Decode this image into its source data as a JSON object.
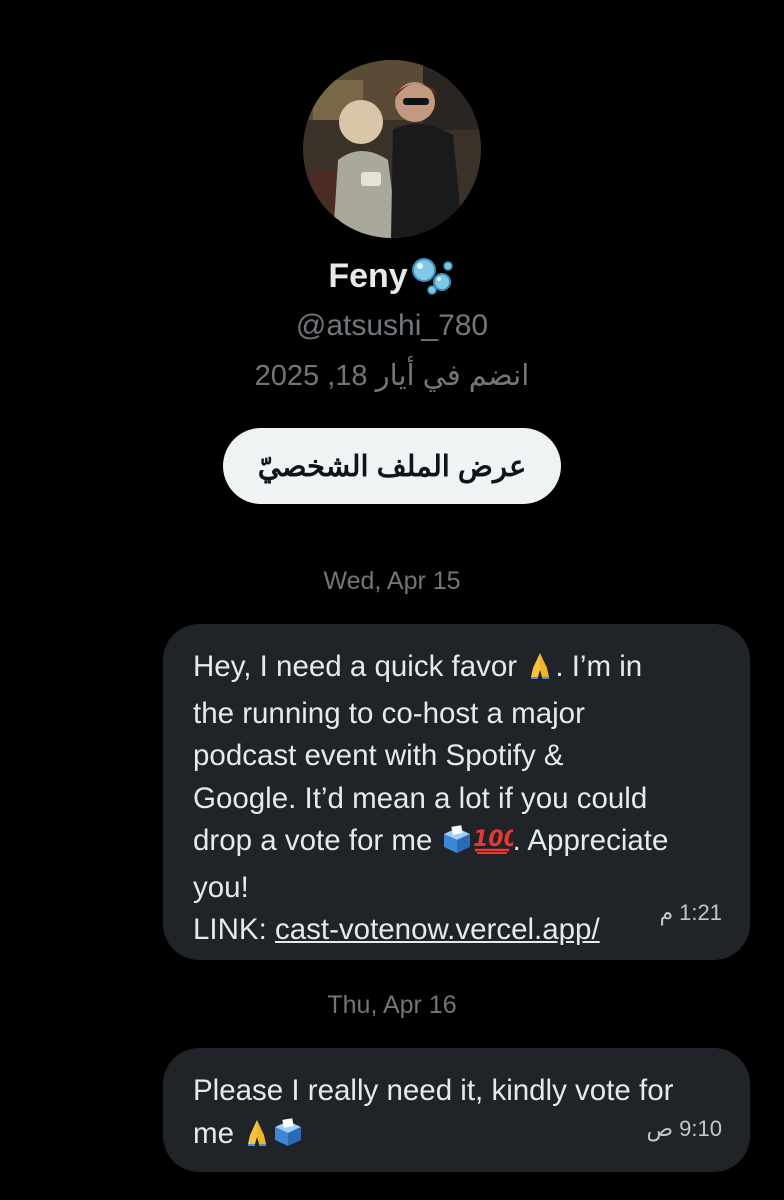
{
  "profile": {
    "display_name": "Feny",
    "name_icon": "bubbles-icon",
    "handle": "@atsushi_780",
    "joined": "انضم في أيار 18, 2025",
    "view_profile_label": "عرض الملف الشخصيّ"
  },
  "conversation": {
    "dates": [
      "Wed, Apr 15",
      "Thu, Apr 16"
    ],
    "messages": [
      {
        "text_line_1": "Hey, I need a quick favor ",
        "text_line_1b": ". I’m in",
        "text_rest": "the running to co-host a major\npodcast event with Spotify &\nGoogle. It’d mean a lot if you could\ndrop a vote for me ",
        "text_after_emoji": ". Appreciate\nyou!",
        "link_prefix": "LINK: ",
        "link_text": "cast-votenow.vercel.app/",
        "time": "1:21 م"
      },
      {
        "text_line_1": "Please I really need it, kindly vote for",
        "text_line_2": "me ",
        "time": "9:10 ص"
      }
    ]
  },
  "icons": {
    "pray": "folded-hands-icon",
    "ballot": "ballot-box-icon",
    "hundred": "hundred-points-icon"
  },
  "colors": {
    "background": "#000000",
    "bubble": "#202327",
    "muted_text": "#71767b",
    "button_bg": "#eff3f4"
  }
}
